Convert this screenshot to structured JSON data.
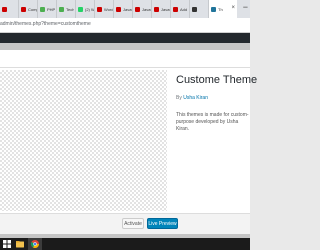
{
  "browser": {
    "tabs": [
      {
        "label": "",
        "color": "#cc0000",
        "icon": "youtube-icon"
      },
      {
        "label": "Compr",
        "color": "#cc0000",
        "icon": "youtube-icon"
      },
      {
        "label": "PHP T",
        "color": "#4caf50",
        "icon": "site-icon"
      },
      {
        "label": "Tech",
        "color": "#4caf50",
        "icon": "site-icon"
      },
      {
        "label": "(2) W",
        "color": "#25d366",
        "icon": "whatsapp-icon"
      },
      {
        "label": "Wordp",
        "color": "#cc0000",
        "icon": "youtube-icon"
      },
      {
        "label": "Javas",
        "color": "#cc0000",
        "icon": "youtube-icon"
      },
      {
        "label": "Javas",
        "color": "#cc0000",
        "icon": "youtube-icon"
      },
      {
        "label": "Javas",
        "color": "#cc0000",
        "icon": "youtube-icon"
      },
      {
        "label": "Add",
        "color": "#cc0000",
        "icon": "youtube-icon"
      },
      {
        "label": "",
        "color": "#333333",
        "icon": "page-icon"
      }
    ],
    "active_tab": {
      "label": "Th",
      "color": "#21759b",
      "icon": "wordpress-icon"
    },
    "close_glyph": "×",
    "window_control": "−",
    "url": "admin/themes.php?theme=customtheme"
  },
  "theme": {
    "name": "Custome Theme",
    "author_prefix": "By",
    "author": "Usha Kiran",
    "description": "This themes is made for custom-purpose developed by Usha Kiran."
  },
  "footer": {
    "activate_label": "Activate",
    "live_preview_label": "Live Preview"
  },
  "taskbar": {
    "items": [
      {
        "icon": "windows-start-icon"
      },
      {
        "icon": "file-explorer-icon"
      },
      {
        "icon": "chrome-icon"
      }
    ]
  },
  "colors": {
    "admin_bar": "#23282d",
    "primary_button": "#0085ba",
    "link": "#0073aa"
  }
}
